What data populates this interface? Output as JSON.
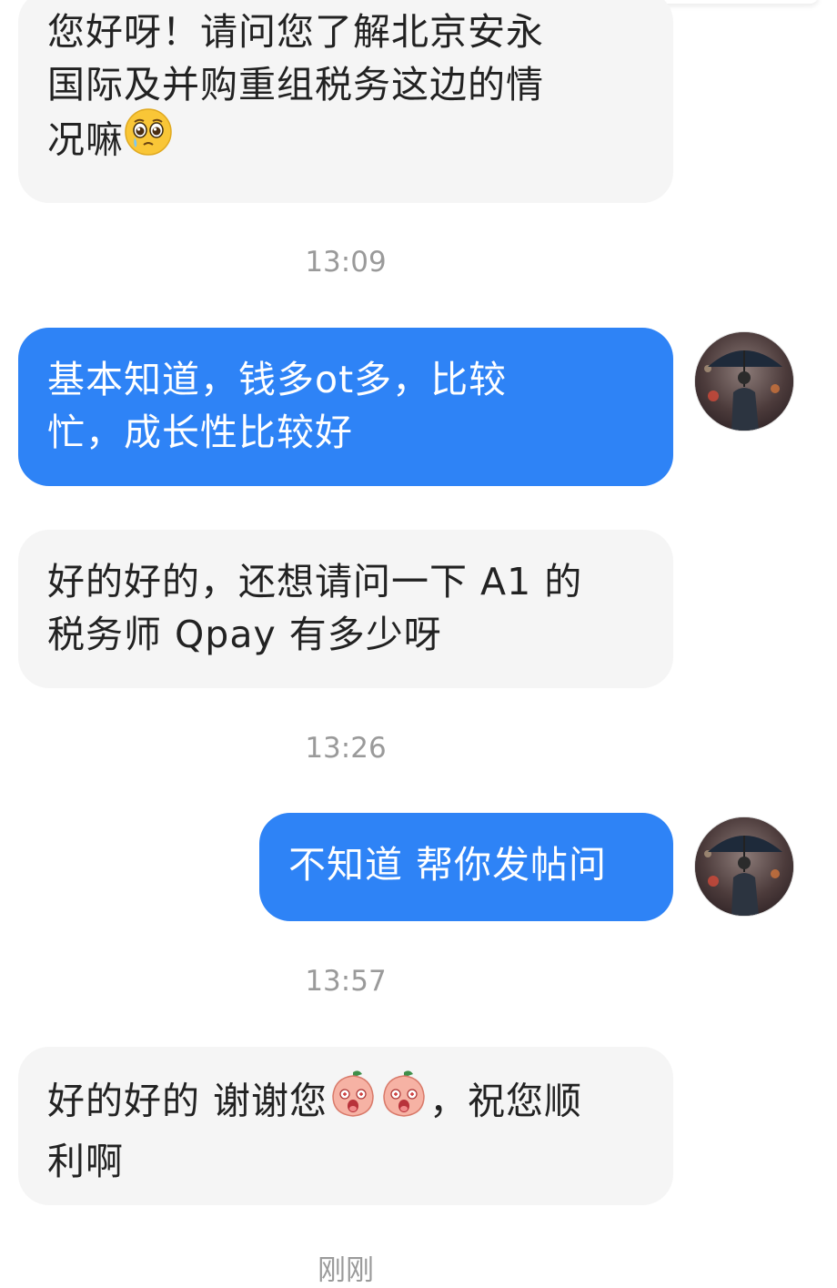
{
  "messages": [
    {
      "side": "in",
      "lines": [
        "您好呀！请问您了解北京安永",
        "国际及并购重组税务这边的情",
        "况嘛"
      ],
      "emoji": "pleading-face"
    },
    {
      "time": "13:09"
    },
    {
      "side": "out",
      "lines": [
        "基本知道，钱多ot多，比较",
        "忙，成长性比较好"
      ]
    },
    {
      "side": "in",
      "lines": [
        "好的好的，还想请问一下 A1 的",
        "税务师 Qpay 有多少呀"
      ]
    },
    {
      "time": "13:26"
    },
    {
      "side": "out",
      "lines": [
        "不知道 帮你发帖问"
      ]
    },
    {
      "time": "13:57"
    },
    {
      "side": "in",
      "lines": [
        "好的好的 谢谢您",
        "，祝您顺",
        "利啊"
      ],
      "emoji": "peach-face"
    },
    {
      "time": "刚刚"
    }
  ],
  "colors": {
    "outgoing_bubble": "#2e83f6",
    "incoming_bubble": "#f5f5f5",
    "timestamp": "#9a9a9a"
  },
  "icons": [
    "pleading-face-icon",
    "peach-face-icon",
    "user-avatar"
  ]
}
